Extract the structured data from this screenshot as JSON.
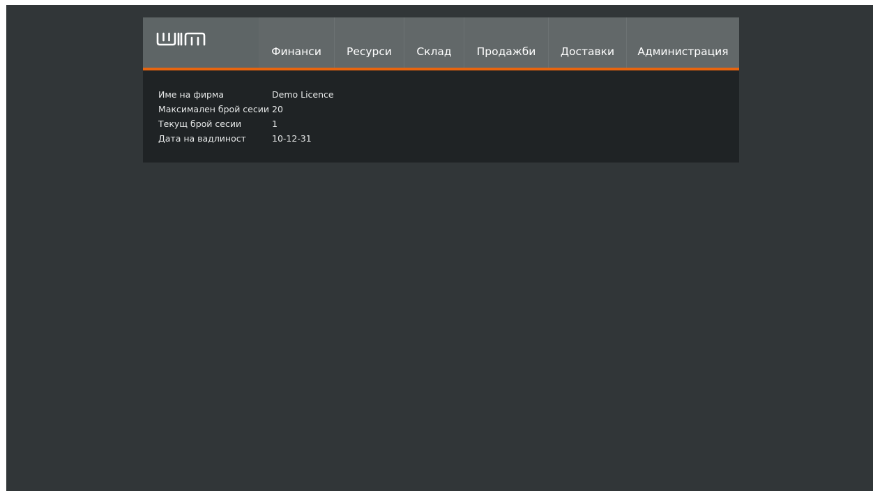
{
  "app": {
    "logo_name": "wim-logo",
    "accent_color": "#e8650f"
  },
  "nav": {
    "items": [
      {
        "label": "Финанси"
      },
      {
        "label": "Ресурси"
      },
      {
        "label": "Склад"
      },
      {
        "label": "Продажби"
      },
      {
        "label": "Доставки"
      },
      {
        "label": "Администрация"
      }
    ]
  },
  "license_info": {
    "rows": [
      {
        "label": "Име на фирма",
        "value": "Demo Licence"
      },
      {
        "label": "Максимален брой сесии",
        "value": "20"
      },
      {
        "label": "Текущ брой сесии",
        "value": "1"
      },
      {
        "label": "Дата на вадлиност",
        "value": "10-12-31"
      }
    ]
  }
}
